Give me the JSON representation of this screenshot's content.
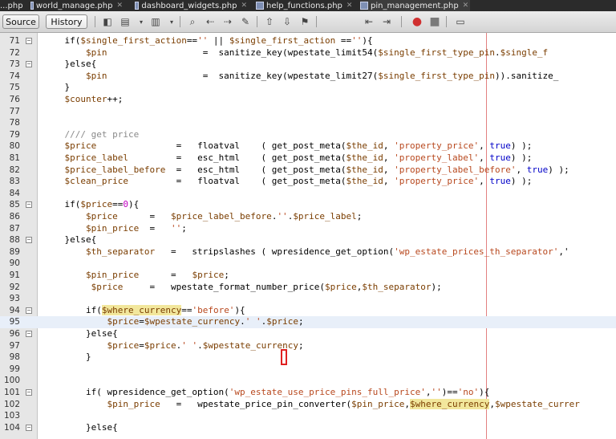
{
  "tabs": [
    {
      "label": "...php",
      "active": false
    },
    {
      "label": "world_manage.php",
      "active": false
    },
    {
      "label": "dashboard_widgets.php",
      "active": false
    },
    {
      "label": "help_functions.php",
      "active": false
    },
    {
      "label": "pin_management.php",
      "active": true
    }
  ],
  "toolbar": {
    "source_label": "Source",
    "history_label": "History",
    "icons": [
      "last-edit-icon",
      "back-icon",
      "forward-icon",
      "find-selection-icon",
      "find-previous-icon",
      "find-next-icon",
      "toggle-highlight-icon",
      "prev-bookmark-icon",
      "next-bookmark-icon",
      "toggle-bookmark-icon",
      "shift-left-icon",
      "shift-right-icon",
      "start-macro-icon",
      "stop-macro-icon",
      "comment-icon"
    ]
  },
  "editor": {
    "lines": [
      {
        "n": "71",
        "fold": true,
        "code": "    if($single_first_action=='' || $single_first_action ==''){"
      },
      {
        "n": "72",
        "fold": false,
        "code": "        $pin                  =  sanitize_key(wpestate_limit54($single_first_type_pin.$single_f"
      },
      {
        "n": "73",
        "fold": true,
        "code": "    }else{"
      },
      {
        "n": "74",
        "fold": false,
        "code": "        $pin                  =  sanitize_key(wpestate_limit27($single_first_type_pin)).sanitize_"
      },
      {
        "n": "75",
        "fold": false,
        "code": "    }"
      },
      {
        "n": "76",
        "fold": false,
        "code": "    $counter++;"
      },
      {
        "n": "77",
        "fold": false,
        "code": ""
      },
      {
        "n": "78",
        "fold": false,
        "code": ""
      },
      {
        "n": "79",
        "fold": false,
        "code": "    //// get price"
      },
      {
        "n": "80",
        "fold": false,
        "code": "    $price               =   floatval    ( get_post_meta($the_id, 'property_price', true) );"
      },
      {
        "n": "81",
        "fold": false,
        "code": "    $price_label         =   esc_html    ( get_post_meta($the_id, 'property_label', true) );"
      },
      {
        "n": "82",
        "fold": false,
        "code": "    $price_label_before  =   esc_html    ( get_post_meta($the_id, 'property_label_before', true) );"
      },
      {
        "n": "83",
        "fold": false,
        "code": "    $clean_price         =   floatval    ( get_post_meta($the_id, 'property_price', true) );"
      },
      {
        "n": "84",
        "fold": false,
        "code": ""
      },
      {
        "n": "85",
        "fold": true,
        "code": "    if($price==0){"
      },
      {
        "n": "86",
        "fold": false,
        "code": "        $price      =   $price_label_before.''.$price_label;"
      },
      {
        "n": "87",
        "fold": false,
        "code": "        $pin_price  =   '';"
      },
      {
        "n": "88",
        "fold": true,
        "code": "    }else{"
      },
      {
        "n": "89",
        "fold": false,
        "code": "        $th_separator   =   stripslashes ( wpresidence_get_option('wp_estate_prices_th_separator','"
      },
      {
        "n": "90",
        "fold": false,
        "code": ""
      },
      {
        "n": "91",
        "fold": false,
        "code": "        $pin_price      =   $price;"
      },
      {
        "n": "92",
        "fold": false,
        "code": "         $price     =   wpestate_format_number_price($price,$th_separator);"
      },
      {
        "n": "93",
        "fold": false,
        "code": ""
      },
      {
        "n": "94",
        "fold": true,
        "code": "        if($where_currency=='before'){"
      },
      {
        "n": "95",
        "fold": false,
        "code": "            $price=$wpestate_currency.' '.$price;"
      },
      {
        "n": "96",
        "fold": true,
        "code": "        }else{"
      },
      {
        "n": "97",
        "fold": false,
        "code": "            $price=$price.' '.$wpestate_currency;"
      },
      {
        "n": "98",
        "fold": false,
        "code": "        }"
      },
      {
        "n": "99",
        "fold": false,
        "code": ""
      },
      {
        "n": "100",
        "fold": false,
        "code": ""
      },
      {
        "n": "101",
        "fold": true,
        "code": "        if( wpresidence_get_option('wp_estate_use_price_pins_full_price','')=='no'){"
      },
      {
        "n": "102",
        "fold": false,
        "code": "            $pin_price   =   wpestate_price_pin_converter($pin_price,$where_currency,$wpestate_currer"
      },
      {
        "n": "103",
        "fold": false,
        "code": ""
      },
      {
        "n": "104",
        "fold": true,
        "code": "        }else{"
      }
    ],
    "current_line": "95",
    "colors": {
      "variable": "#7a3d00",
      "string": "#b8481e",
      "keyword": "#0000c8",
      "comment": "#8a8a8a",
      "number": "#c000c0",
      "highlight": "#f2e79c",
      "margin": "#e28080"
    }
  }
}
